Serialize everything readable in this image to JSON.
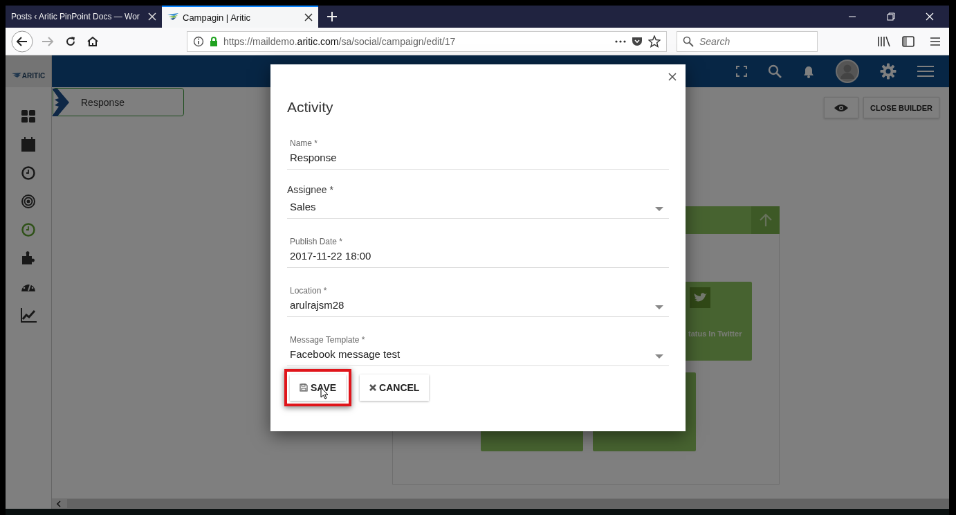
{
  "browser": {
    "tabs": [
      {
        "title": "Posts ‹ Aritic PinPoint Docs — Wor",
        "selected": false
      },
      {
        "title": "Campagin | Aritic",
        "selected": true
      }
    ],
    "url": {
      "prefix": "https://maildemo.",
      "domain": "aritic.com",
      "path": "/sa/social/campaign/edit/17"
    },
    "search": {
      "placeholder": "Search"
    }
  },
  "app": {
    "logo": "ARITIC",
    "sidebar": {
      "items": [
        {
          "selected": false
        },
        {
          "selected": false
        },
        {
          "selected": false
        },
        {
          "selected": false
        },
        {
          "selected": true
        },
        {
          "selected": false
        },
        {
          "selected": false
        },
        {
          "selected": false
        }
      ]
    },
    "canvas": {
      "node": "Response",
      "builder_button": "CLOSE BUILDER",
      "card_text": "tatus In Twitter"
    }
  },
  "modal": {
    "title": "Activity",
    "fields": [
      {
        "kind": "text",
        "label": "Name *",
        "value": "Response"
      },
      {
        "kind": "labeled-select",
        "label": "Assignee *",
        "value": "Sales"
      },
      {
        "kind": "text",
        "label": "Publish Date *",
        "value": "2017-11-22 18:00"
      },
      {
        "kind": "select",
        "label": "Location *",
        "value": "arulrajsm28"
      },
      {
        "kind": "select",
        "label": "Message Template *",
        "value": "Facebook message test"
      }
    ],
    "buttons": [
      {
        "kind": "save",
        "label": "SAVE",
        "highlighted": true
      },
      {
        "kind": "cancel",
        "label": "CANCEL",
        "highlighted": false
      }
    ]
  }
}
